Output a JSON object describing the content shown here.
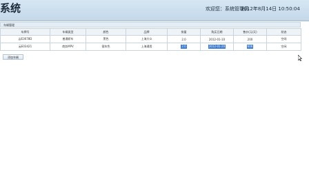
{
  "header": {
    "title": "系统",
    "welcome": "欢迎您：系统管理员",
    "datetime": "2012年8月14日 10:50:04"
  },
  "panel": {
    "title": "车辆管理"
  },
  "table": {
    "columns": [
      "车牌号",
      "车辆类型",
      "颜色",
      "品牌",
      "排量",
      "购买日期",
      "售价(元/天)",
      "状态"
    ],
    "rows": [
      {
        "plate": "云E3678D",
        "type": "普通轿车",
        "color": "黑色",
        "brand": "上海大众",
        "displacement": "2.0",
        "date": "2012-01-10",
        "price": "200",
        "status": "空闲"
      },
      {
        "plate": "云E03421",
        "type": "商务MPV",
        "color": "银灰色",
        "brand": "上海通用",
        "displacement": "2.0",
        "date": "2012-01-20",
        "price": "600",
        "status": "空闲"
      }
    ]
  },
  "toolbar": {
    "add_label": "添加车辆"
  },
  "colors": {
    "header_bg": "#c4d8ea",
    "selection": "#3a7bd5"
  }
}
